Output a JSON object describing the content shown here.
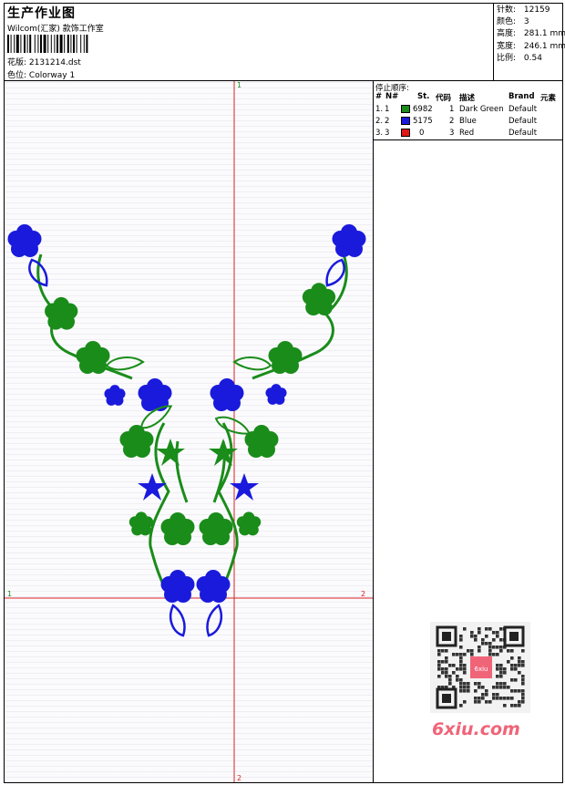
{
  "header": {
    "title": "生产作业图",
    "company": "Wilcom(汇家) 款饰工作室",
    "file_label": "花版:",
    "file_name": "2131214.dst",
    "color_label": "色位:",
    "color_name": "Colorway 1"
  },
  "stats": [
    {
      "label": "针数:",
      "value": "12159"
    },
    {
      "label": "颜色:",
      "value": "3"
    },
    {
      "label": "高度:",
      "value": "281.1 mm"
    },
    {
      "label": "宽度:",
      "value": "246.1 mm"
    },
    {
      "label": "比例:",
      "value": "0.54"
    }
  ],
  "panel": {
    "title": "停止顺序:",
    "columns": {
      "num": "#",
      "no": "N#",
      "st": "St.",
      "code": "代码",
      "desc": "描述",
      "brand": "Brand",
      "element": "元素"
    },
    "rows": [
      {
        "num": "1.",
        "no": "1",
        "color": "#1a8c1a",
        "st": "6982",
        "code": "1",
        "desc": "Dark Green",
        "brand": "Default"
      },
      {
        "num": "2.",
        "no": "2",
        "color": "#1a1adc",
        "st": "5175",
        "code": "2",
        "desc": "Blue",
        "brand": "Default"
      },
      {
        "num": "3.",
        "no": "3",
        "color": "#e01818",
        "st": "0",
        "code": "3",
        "desc": "Red",
        "brand": "Default"
      }
    ]
  },
  "design": {
    "guide_labels": {
      "top": "1",
      "bottom": "2",
      "left": "1",
      "right": "2"
    },
    "colors": {
      "green": "#1a8c1a",
      "blue": "#1a1adc",
      "red_guide": "#dd2222"
    }
  },
  "watermark": {
    "qr_text": "6xiu",
    "site": "6xiu.com"
  }
}
